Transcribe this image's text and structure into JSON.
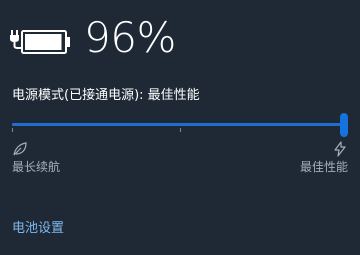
{
  "battery": {
    "percent_text": "96%",
    "level": 0.96,
    "charging": true,
    "icon": "battery-charging-icon"
  },
  "power_mode": {
    "label": "电源模式(已接通电源): 最佳性能",
    "slider_value": 1.0,
    "left_label": "最长续航",
    "right_label": "最佳性能",
    "left_icon": "leaf-icon",
    "right_icon": "lightning-icon"
  },
  "links": {
    "battery_settings": "电池设置"
  },
  "colors": {
    "background": "#1e2935",
    "accent": "#1572df",
    "link": "#7fb7ee",
    "muted_text": "#a6afb8"
  }
}
